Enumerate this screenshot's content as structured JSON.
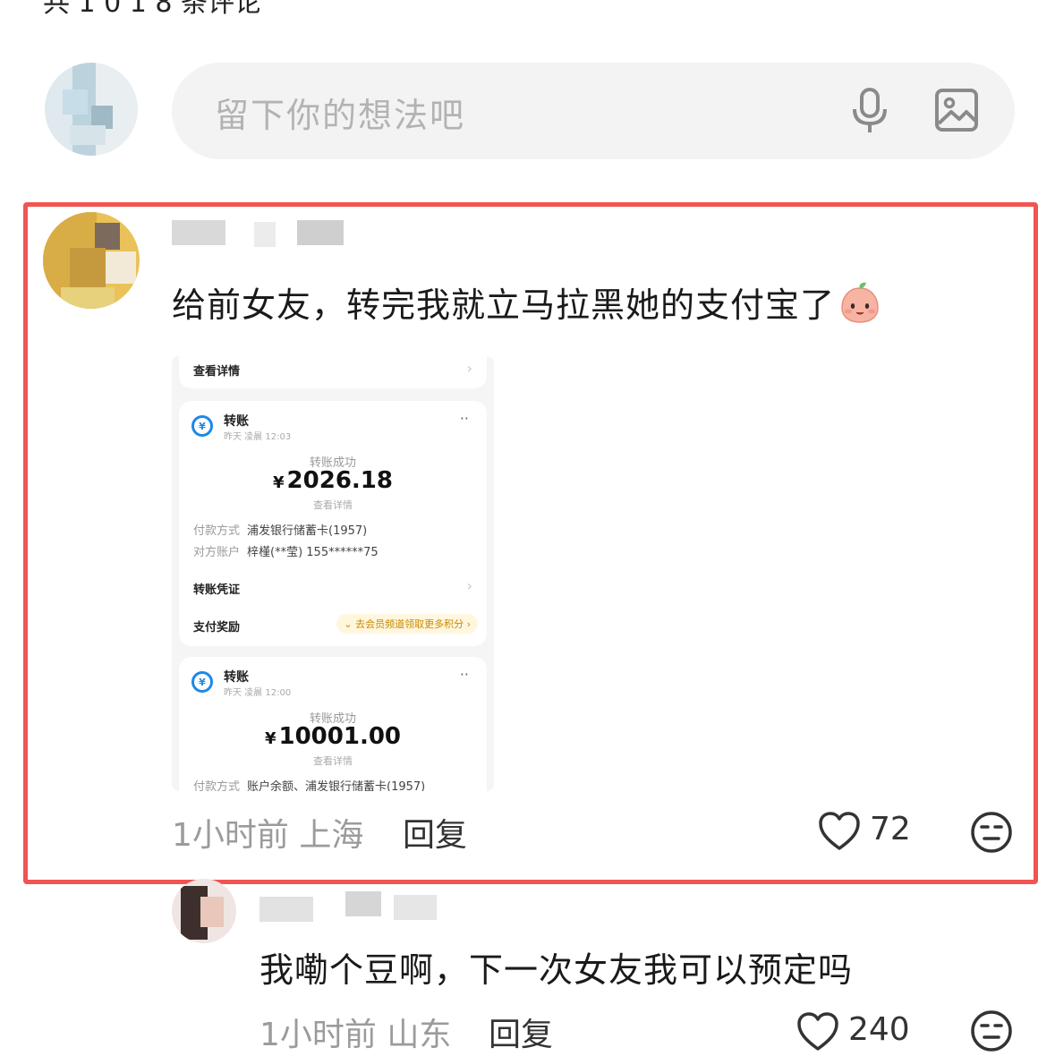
{
  "header": {
    "partial_text": "共 1 0 1 8 条评论"
  },
  "composer": {
    "placeholder": "留下你的想法吧",
    "icons": [
      "microphone-icon",
      "image-icon"
    ]
  },
  "comments": [
    {
      "text": "给前女友，转完我就立马拉黑她的支付宝了",
      "emoji": "peach-face-emoji",
      "screenshot": {
        "top_detail": "查看详情",
        "transfers": [
          {
            "title": "转账",
            "time": "昨天 凌晨 12:03",
            "status": "转账成功",
            "currency": "¥",
            "amount": "2026.18",
            "link": "查看详情",
            "pay_method_label": "付款方式",
            "pay_method_value": "浦发银行储蓄卡(1957)",
            "account_label": "对方账户",
            "account_value": "梓槿(**莹) 155******75",
            "voucher": "转账凭证",
            "reward_label": "支付奖励",
            "reward_value": "去会员频道领取更多积分"
          },
          {
            "title": "转账",
            "time": "昨天 凌晨 12:00",
            "status": "转账成功",
            "currency": "¥",
            "amount": "10001.00",
            "link": "查看详情",
            "pay_method_label": "付款方式",
            "pay_method_value": "账户余额、浦发银行储蓄卡(1957)"
          }
        ]
      },
      "time": "1小时前",
      "location": "上海",
      "reply_label": "回复",
      "likes": "72"
    },
    {
      "text": "我嘞个豆啊，下一次女友我可以预定吗",
      "time": "1小时前",
      "location": "山东",
      "reply_label": "回复",
      "likes": "240"
    }
  ],
  "colors": {
    "highlight_frame": "#f15451",
    "alipay_blue": "#1e88e5"
  }
}
